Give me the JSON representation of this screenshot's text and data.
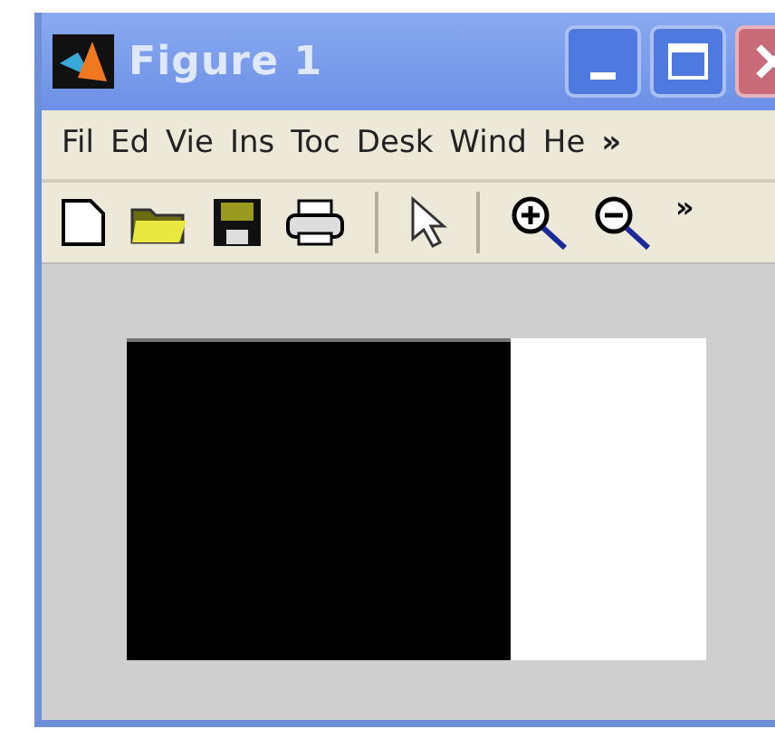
{
  "window": {
    "title": "Figure 1"
  },
  "menu": {
    "items": [
      "Fil",
      "Ed",
      "Vie",
      "Ins",
      "Toc",
      "Desk",
      "Wind",
      "He"
    ],
    "overflow": "»"
  },
  "toolbar": {
    "tools": [
      {
        "kind": "new"
      },
      {
        "kind": "open"
      },
      {
        "kind": "save"
      },
      {
        "kind": "print"
      },
      {
        "kind": "separator"
      },
      {
        "kind": "pointer"
      },
      {
        "kind": "separator"
      },
      {
        "kind": "zoom-in"
      },
      {
        "kind": "zoom-out"
      }
    ],
    "overflow": "»"
  }
}
